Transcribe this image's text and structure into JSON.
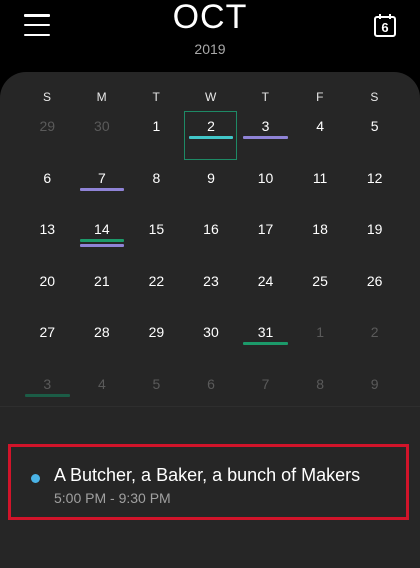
{
  "header": {
    "month": "OCT",
    "year": "2019",
    "today_day": "6"
  },
  "colors": {
    "purple": "#8f83d6",
    "teal": "#42c7c9",
    "green": "#1c9a6a",
    "darkgreen": "#1b5c46",
    "event_dot": "#4ab3e6",
    "highlight_border": "#d1142a"
  },
  "calendar": {
    "weekdays": [
      "S",
      "M",
      "T",
      "W",
      "T",
      "F",
      "S"
    ],
    "selected_day": "2",
    "days": [
      {
        "label": "29",
        "muted": true,
        "bars": []
      },
      {
        "label": "30",
        "muted": true,
        "bars": []
      },
      {
        "label": "1",
        "muted": false,
        "bars": []
      },
      {
        "label": "2",
        "muted": false,
        "bars": [
          "teal"
        ],
        "selected": true
      },
      {
        "label": "3",
        "muted": false,
        "bars": [
          "purple"
        ]
      },
      {
        "label": "4",
        "muted": false,
        "bars": []
      },
      {
        "label": "5",
        "muted": false,
        "bars": []
      },
      {
        "label": "6",
        "muted": false,
        "bars": []
      },
      {
        "label": "7",
        "muted": false,
        "bars": [
          "purple"
        ]
      },
      {
        "label": "8",
        "muted": false,
        "bars": []
      },
      {
        "label": "9",
        "muted": false,
        "bars": []
      },
      {
        "label": "10",
        "muted": false,
        "bars": []
      },
      {
        "label": "11",
        "muted": false,
        "bars": []
      },
      {
        "label": "12",
        "muted": false,
        "bars": []
      },
      {
        "label": "13",
        "muted": false,
        "bars": []
      },
      {
        "label": "14",
        "muted": false,
        "bars": [
          "green",
          "purple"
        ]
      },
      {
        "label": "15",
        "muted": false,
        "bars": []
      },
      {
        "label": "16",
        "muted": false,
        "bars": []
      },
      {
        "label": "17",
        "muted": false,
        "bars": []
      },
      {
        "label": "18",
        "muted": false,
        "bars": []
      },
      {
        "label": "19",
        "muted": false,
        "bars": []
      },
      {
        "label": "20",
        "muted": false,
        "bars": []
      },
      {
        "label": "21",
        "muted": false,
        "bars": []
      },
      {
        "label": "22",
        "muted": false,
        "bars": []
      },
      {
        "label": "23",
        "muted": false,
        "bars": []
      },
      {
        "label": "24",
        "muted": false,
        "bars": []
      },
      {
        "label": "25",
        "muted": false,
        "bars": []
      },
      {
        "label": "26",
        "muted": false,
        "bars": []
      },
      {
        "label": "27",
        "muted": false,
        "bars": []
      },
      {
        "label": "28",
        "muted": false,
        "bars": []
      },
      {
        "label": "29",
        "muted": false,
        "bars": []
      },
      {
        "label": "30",
        "muted": false,
        "bars": []
      },
      {
        "label": "31",
        "muted": false,
        "bars": [
          "green"
        ]
      },
      {
        "label": "1",
        "muted": true,
        "bars": []
      },
      {
        "label": "2",
        "muted": true,
        "bars": []
      },
      {
        "label": "3",
        "muted": true,
        "bars": [
          "darkgreen"
        ]
      },
      {
        "label": "4",
        "muted": true,
        "bars": []
      },
      {
        "label": "5",
        "muted": true,
        "bars": []
      },
      {
        "label": "6",
        "muted": true,
        "bars": []
      },
      {
        "label": "7",
        "muted": true,
        "bars": []
      },
      {
        "label": "8",
        "muted": true,
        "bars": []
      },
      {
        "label": "9",
        "muted": true,
        "bars": []
      }
    ]
  },
  "event": {
    "title": "A Butcher, a Baker, a bunch of Makers",
    "time": "5:00 PM - 9:30 PM",
    "dot_color": "#4ab3e6"
  },
  "icons": {
    "menu": "hamburger-menu-icon",
    "today": "calendar-today-icon"
  }
}
